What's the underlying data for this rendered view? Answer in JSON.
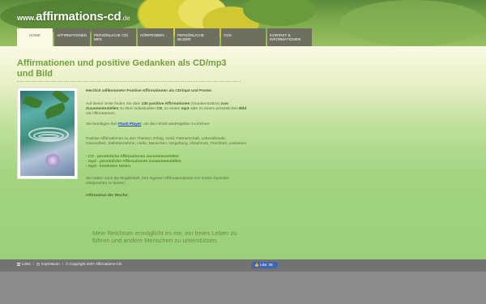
{
  "site": {
    "logo_www": "www.",
    "logo_name": "affirmations-cd",
    "logo_tld": ".de"
  },
  "nav": {
    "items": [
      {
        "label": "Home",
        "active": true
      },
      {
        "label": "Affirmationen",
        "active": false
      },
      {
        "label": "Persönliche CD/ MP3",
        "active": false
      },
      {
        "label": "Hörproben",
        "active": false
      },
      {
        "label": "Persönliche Bilder",
        "active": false
      },
      {
        "label": "CDs",
        "active": false
      },
      {
        "label": "Kontakt & Informationen",
        "active": false
      }
    ]
  },
  "main": {
    "title": "Affirmationen und positive Gedanken als CD/mp3 und Bild",
    "welcome": "Herzlich willkommen! Positive Affirmationen als CD/mp3 und Poster.",
    "intro_1": "Auf dieser Seite finden Sie über ",
    "intro_count": "230 positive Affirmationen",
    "intro_2": " (Glaubenssätze) ",
    "intro_action": "zum Zusammenstellen",
    "intro_3": " zu Ihrer individuellen ",
    "intro_cd": "CD",
    "intro_4": ", zu einem ",
    "intro_mp3": "mp3",
    "intro_5": " oder zu einem persönlichen ",
    "intro_bild": "Bild",
    "intro_6": " mit Affirmationen.",
    "flash_1": "Sie benötigen den ",
    "flash_link": "Flash Player",
    "flash_2": ", um den Inhalt wiedergeben zu können.",
    "topics": "Positive Affirmationen zu den Themen: Erfolg, Geld, Partnerschaft, Lebensfreude, Gesundheit, Selbstannahme, Liebe, Menschen, Vergebung, Abnehmen, Frechheit, Loslassen",
    "links": [
      "- CD - persönliche Affirmationen zusammenstellen",
      "- mp3 - persönliche Affirmationen zusammenstellen",
      "- mp3 - kostenlos testen"
    ],
    "own_texts": "Sie haben auch die Möglichkeit, Ihre eigenen Affirmationstexte von einem Sprecher einsprechen zu lassen.",
    "weekly_label": "Affirmation der Woche:",
    "weekly_text": "Mein Reichtum ermöglicht es mir, ein freies Leben zu führen und andere Menschen zu unterstützen."
  },
  "footer": {
    "links_label": "Links",
    "impressum_label": "Impressum",
    "copyright": "© Copyright 2007 Affirmations-CD",
    "like_label": "Like",
    "like_count": "26"
  },
  "colors": {
    "title_green": "#6fa03a",
    "nav_gray": "#6f6f5f",
    "footer_gray": "#737373",
    "facebook_blue": "#4267b2"
  },
  "icons": [
    "links-icon",
    "impressum-icon",
    "facebook-thumb-icon"
  ]
}
